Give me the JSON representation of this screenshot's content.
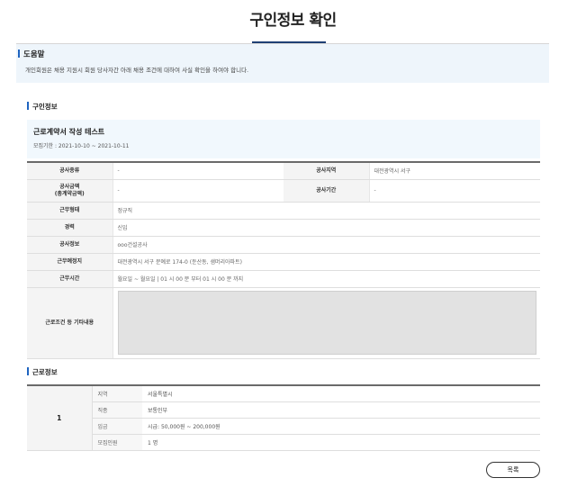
{
  "page": {
    "title": "구인정보 확인"
  },
  "help": {
    "heading": "도움말",
    "text": "개인회원은 채용 지원시 회원 당사자간 아래 채용 조건에 대하여 사실 확인을 하여야 합니다."
  },
  "job_section": {
    "heading": "구인정보",
    "job_title": "근로계약서 작성 테스트",
    "period": "모집기한 : 2021-10-10 ~ 2021-10-11"
  },
  "info_table": {
    "construction_type": {
      "label": "공사종류",
      "value": "-"
    },
    "construction_region": {
      "label": "공사지역",
      "value": "대전광역시 서구"
    },
    "construction_amount": {
      "label": "공사금액\n(총계약금액)",
      "value": "-"
    },
    "construction_period": {
      "label": "공사기간",
      "value": "-"
    },
    "work_type": {
      "label": "근무형태",
      "value": "정규직"
    },
    "career": {
      "label": "경력",
      "value": "신입"
    },
    "construction_info": {
      "label": "공사정보",
      "value": "ooo건설공사"
    },
    "work_place": {
      "label": "근무예정지",
      "value": "대전광역시 서구 문예로 174-0 (둔산동, 샘머리아파트)"
    },
    "work_hours": {
      "label": "근무시간",
      "value": "월요일 ~ 월요일 | 01 시 00 분 부터 01 시 00 분 까지"
    },
    "other_conditions": {
      "label": "근로조건 등 기타내용",
      "value": ""
    }
  },
  "work_section": {
    "heading": "근로정보",
    "number": "1",
    "rows": [
      {
        "label": "지역",
        "value": "서울특별시"
      },
      {
        "label": "직종",
        "value": "보통인부"
      },
      {
        "label": "임금",
        "value": "시급: 50,000원 ~ 200,000원"
      },
      {
        "label": "모집인원",
        "value": "1 명"
      }
    ]
  },
  "buttons": {
    "list_label": "목록"
  },
  "colors": {
    "accent": "#1f64c0",
    "title_underline": "#1f3f74",
    "help_bg": "#eef5fb",
    "job_box_bg": "#f1f8fd"
  }
}
